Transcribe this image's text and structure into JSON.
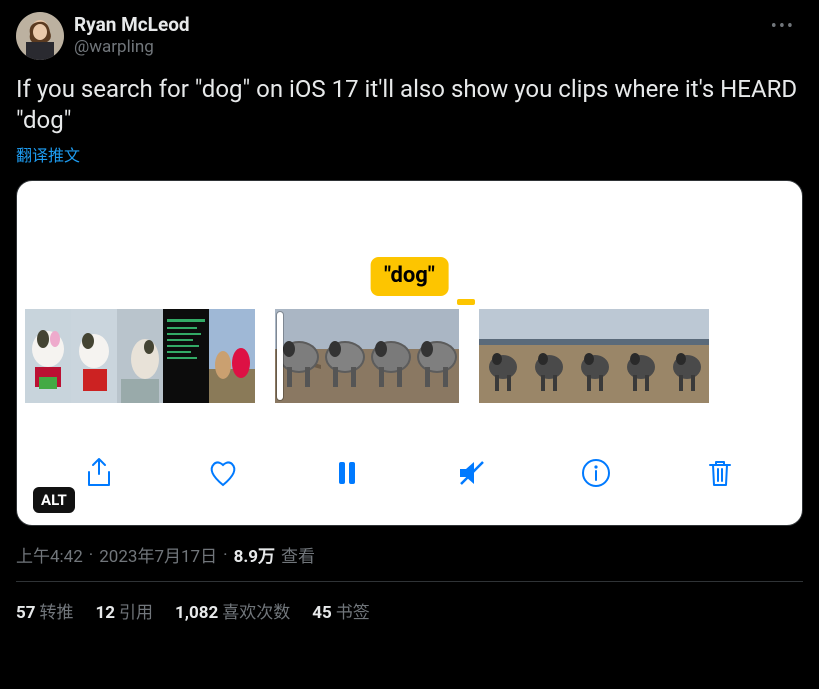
{
  "author": {
    "display_name": "Ryan McLeod",
    "handle": "@warpling"
  },
  "tweet_text": "If you search for \"dog\" on iOS 17 it'll also show you clips where it's HEARD \"dog\"",
  "translate_label": "翻译推文",
  "media": {
    "search_label": "\"dog\"",
    "alt_badge": "ALT"
  },
  "meta": {
    "time": "上午4:42",
    "date": "2023年7月17日",
    "views_number": "8.9万",
    "views_label": "查看"
  },
  "stats": {
    "retweet_num": "57",
    "retweet_label": "转推",
    "quote_num": "12",
    "quote_label": "引用",
    "like_num": "1,082",
    "like_label": "喜欢次数",
    "bookmark_num": "45",
    "bookmark_label": "书签"
  }
}
